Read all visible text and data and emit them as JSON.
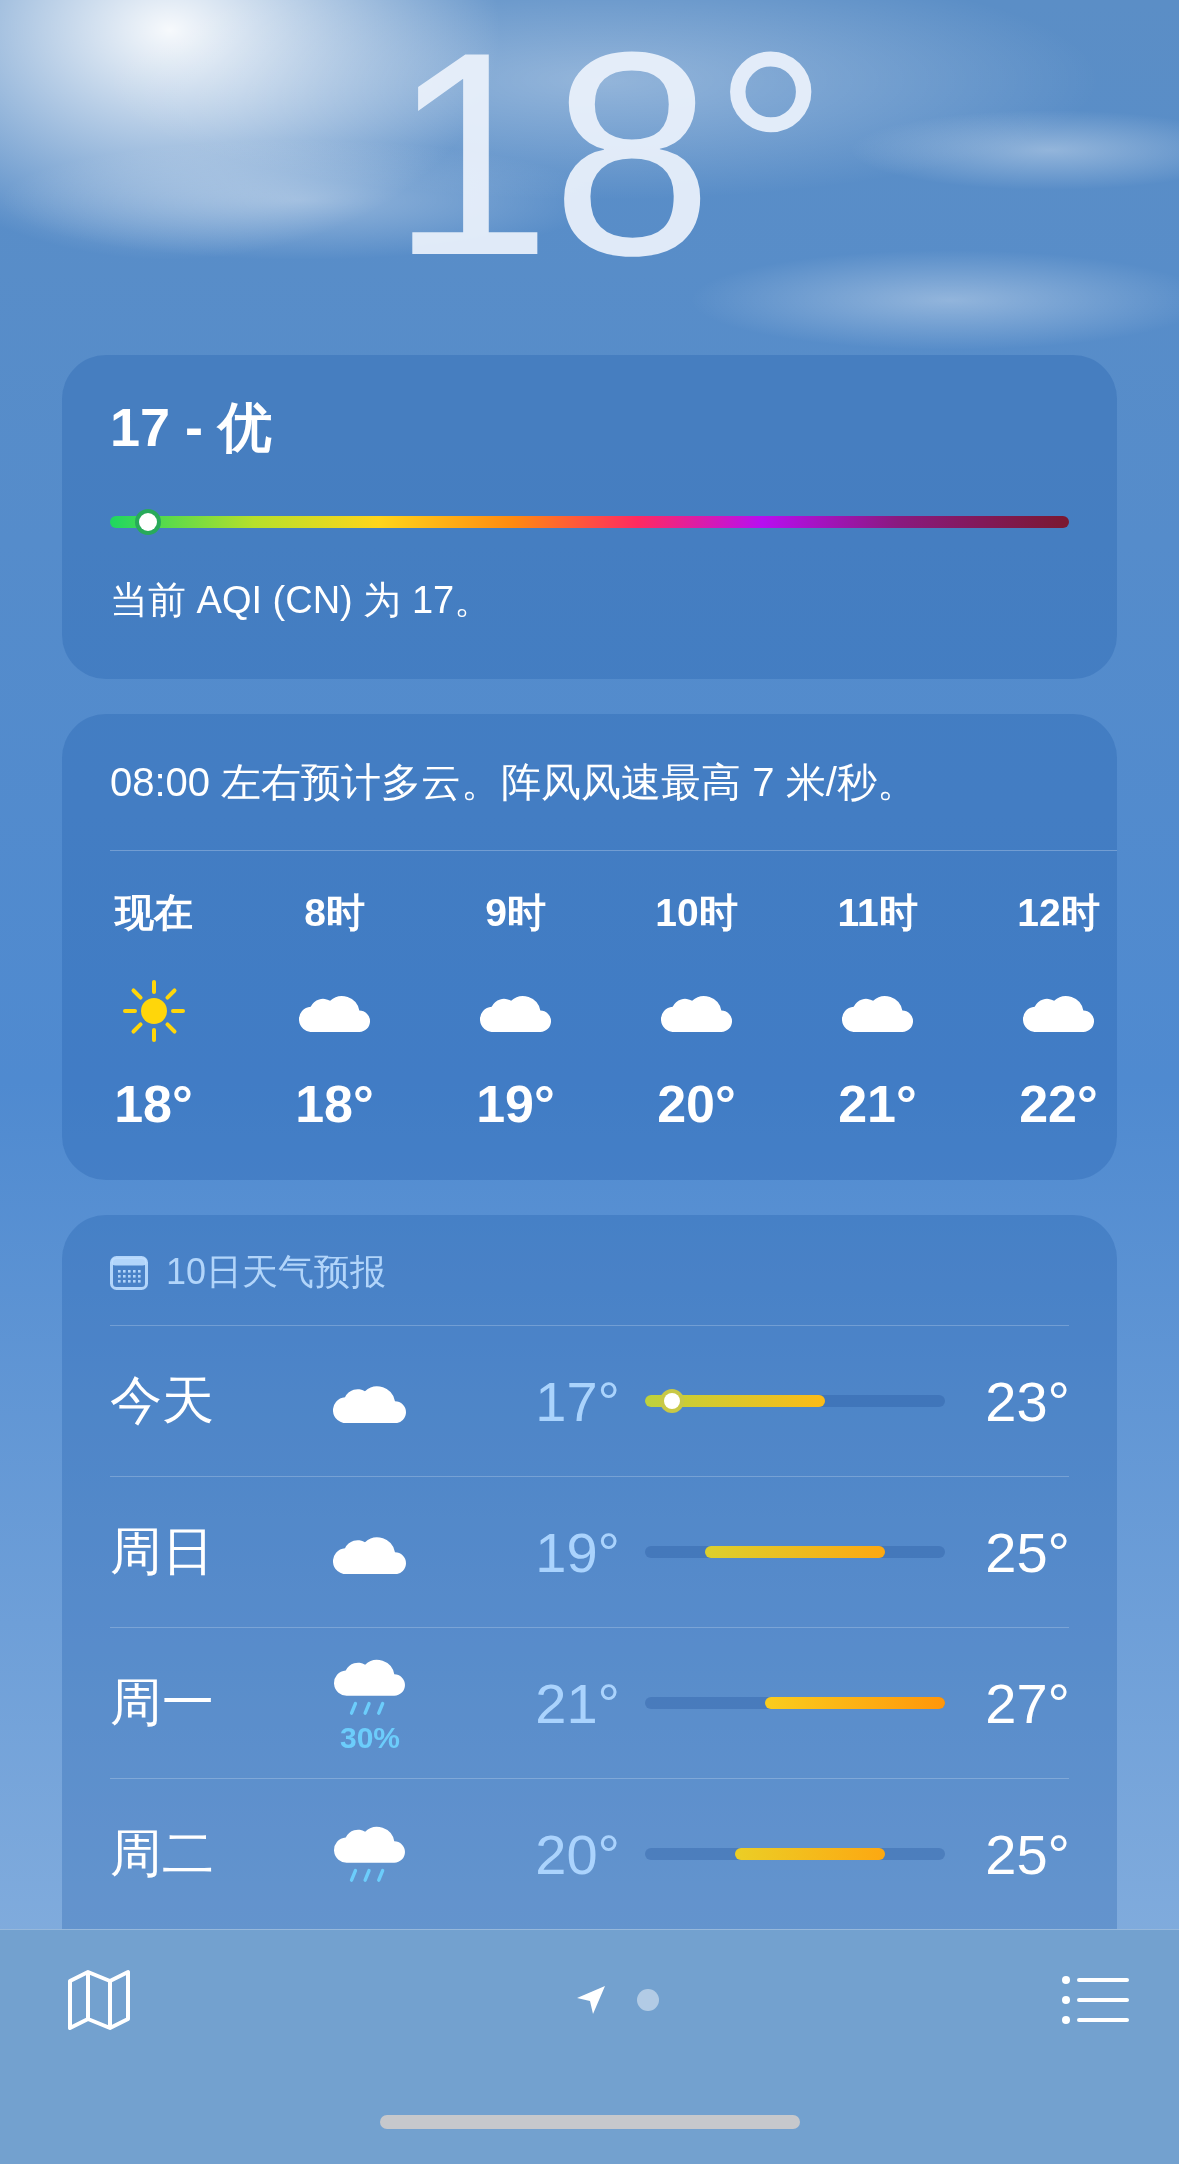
{
  "current": {
    "temperature": "18°"
  },
  "air_quality": {
    "title": "17 - 优",
    "level": 0.04,
    "description": "当前 AQI (CN) 为 17。"
  },
  "hourly": {
    "summary": "08:00 左右预计多云。阵风风速最高 7 米/秒。",
    "hours": [
      {
        "label": "现在",
        "kind": "sun",
        "temp": "18°"
      },
      {
        "label": "8时",
        "kind": "cloud",
        "temp": "18°"
      },
      {
        "label": "9时",
        "kind": "cloud",
        "temp": "19°"
      },
      {
        "label": "10时",
        "kind": "cloud",
        "temp": "20°"
      },
      {
        "label": "11时",
        "kind": "cloud",
        "temp": "21°"
      },
      {
        "label": "12时",
        "kind": "cloud",
        "temp": "22°"
      }
    ]
  },
  "forecast": {
    "title": "10日天气预报",
    "days": [
      {
        "day": "今天",
        "kind": "cloud",
        "low": "17°",
        "high": "23°",
        "level": 0.09
      },
      {
        "day": "周日",
        "kind": "cloud",
        "low": "19°",
        "high": "25°"
      },
      {
        "day": "周一",
        "kind": "rain",
        "precip": "30%",
        "low": "21°",
        "high": "27°"
      },
      {
        "day": "周二",
        "kind": "rain",
        "low": "20°",
        "high": "25°"
      }
    ]
  },
  "toolbar": {
    "pages": [
      {
        "kind": "location",
        "selected": true
      },
      {
        "kind": "dot",
        "selected": false
      }
    ]
  }
}
